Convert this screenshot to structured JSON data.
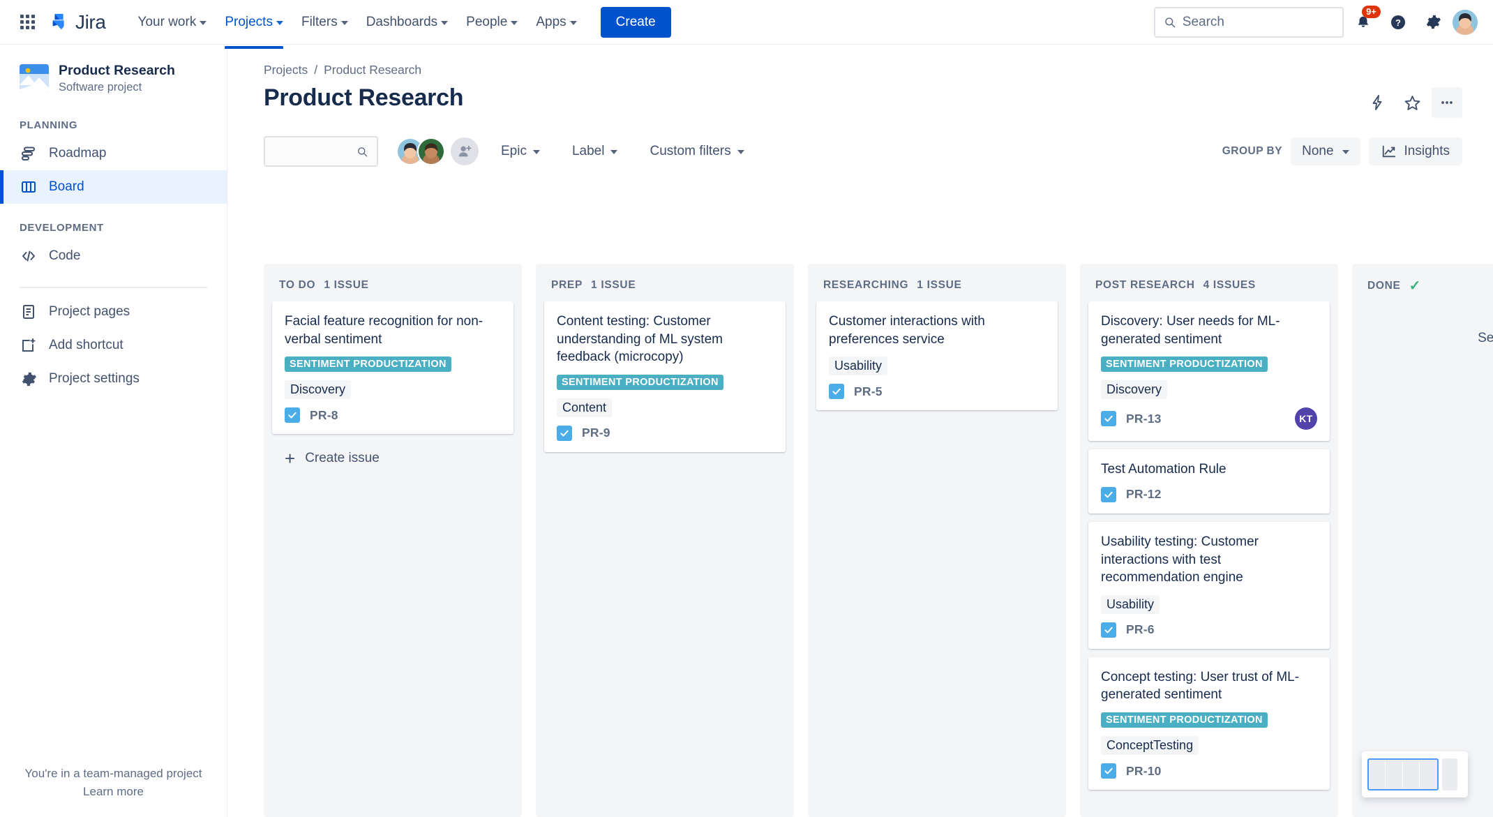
{
  "topnav": {
    "app_switcher_icon": "grid-apps-icon",
    "logo_text": "Jira",
    "menu": [
      {
        "label": "Your work",
        "active": false
      },
      {
        "label": "Projects",
        "active": true
      },
      {
        "label": "Filters",
        "active": false
      },
      {
        "label": "Dashboards",
        "active": false
      },
      {
        "label": "People",
        "active": false
      },
      {
        "label": "Apps",
        "active": false
      }
    ],
    "create_label": "Create",
    "search_placeholder": "Search",
    "search_value": "",
    "notification_badge": "9+",
    "icons": [
      "notification-bell-icon",
      "help-icon",
      "settings-gear-icon",
      "user-avatar"
    ]
  },
  "sidebar": {
    "project_name": "Product Research",
    "project_type": "Software project",
    "sections": [
      {
        "title": "PLANNING",
        "items": [
          {
            "label": "Roadmap",
            "icon": "roadmap-icon",
            "selected": false
          },
          {
            "label": "Board",
            "icon": "board-icon",
            "selected": true
          }
        ]
      },
      {
        "title": "DEVELOPMENT",
        "items": [
          {
            "label": "Code",
            "icon": "code-icon",
            "selected": false
          }
        ]
      }
    ],
    "extra_items": [
      {
        "label": "Project pages",
        "icon": "pages-icon"
      },
      {
        "label": "Add shortcut",
        "icon": "add-shortcut-icon"
      },
      {
        "label": "Project settings",
        "icon": "settings-gear-icon"
      }
    ],
    "footer_text": "You're in a team-managed project",
    "footer_link": "Learn more"
  },
  "header": {
    "breadcrumb": [
      "Projects",
      "Product Research"
    ],
    "breadcrumb_separator": "/",
    "title": "Product Research",
    "actions": [
      "lightning-bolt-icon",
      "star-icon",
      "more-actions-icon"
    ]
  },
  "toolbar": {
    "search_value": "",
    "search_placeholder": "",
    "search_icon": "search-icon",
    "add_people_icon": "add-person-icon",
    "filters": [
      {
        "label": "Epic"
      },
      {
        "label": "Label"
      },
      {
        "label": "Custom filters"
      }
    ],
    "group_by_label": "GROUP BY",
    "group_by_value": "None",
    "insights_label": "Insights",
    "insights_icon": "insights-chart-icon"
  },
  "board": {
    "create_issue_label": "Create issue",
    "see_all_done_label": "See all Done issues",
    "columns": [
      {
        "name": "TO DO",
        "count_label": "1 ISSUE",
        "done": false,
        "show_create": true,
        "cards": [
          {
            "title": "Facial feature recognition for non-verbal sentiment",
            "epic": "SENTIMENT PRODUCTIZATION",
            "label": "Discovery",
            "key": "PR-8",
            "assignee": ""
          }
        ]
      },
      {
        "name": "PREP",
        "count_label": "1 ISSUE",
        "done": false,
        "show_create": false,
        "cards": [
          {
            "title": "Content testing: Customer understanding of ML system feedback (microcopy)",
            "epic": "SENTIMENT PRODUCTIZATION",
            "label": "Content",
            "key": "PR-9",
            "assignee": ""
          }
        ]
      },
      {
        "name": "RESEARCHING",
        "count_label": "1 ISSUE",
        "done": false,
        "show_create": false,
        "cards": [
          {
            "title": "Customer interactions with preferences service",
            "epic": "",
            "label": "Usability",
            "key": "PR-5",
            "assignee": ""
          }
        ]
      },
      {
        "name": "POST RESEARCH",
        "count_label": "4 ISSUES",
        "done": false,
        "show_create": false,
        "cards": [
          {
            "title": "Discovery: User needs for ML-generated sentiment",
            "epic": "SENTIMENT PRODUCTIZATION",
            "label": "Discovery",
            "key": "PR-13",
            "assignee": "KT"
          },
          {
            "title": "Test Automation Rule",
            "epic": "",
            "label": "",
            "key": "PR-12",
            "assignee": ""
          },
          {
            "title": "Usability testing: Customer interactions with test recommendation engine",
            "epic": "",
            "label": "Usability",
            "key": "PR-6",
            "assignee": ""
          },
          {
            "title": "Concept testing: User trust of ML-generated sentiment",
            "epic": "SENTIMENT PRODUCTIZATION",
            "label": "ConceptTesting",
            "key": "PR-10",
            "assignee": ""
          }
        ]
      },
      {
        "name": "DONE",
        "count_label": "",
        "done": true,
        "show_create": false,
        "cards": []
      }
    ]
  },
  "colors": {
    "brand_blue": "#0052cc",
    "epic_teal": "#4bafc3",
    "checkbox_blue": "#4bade8",
    "done_green": "#36b37e",
    "badge_red": "#de350b",
    "avatar_purple": "#5243aa",
    "column_bg": "#f4f5f7",
    "text_primary": "#172b4d",
    "text_subtle": "#5e6c84"
  },
  "minimap": {
    "name": "board-minimap"
  }
}
